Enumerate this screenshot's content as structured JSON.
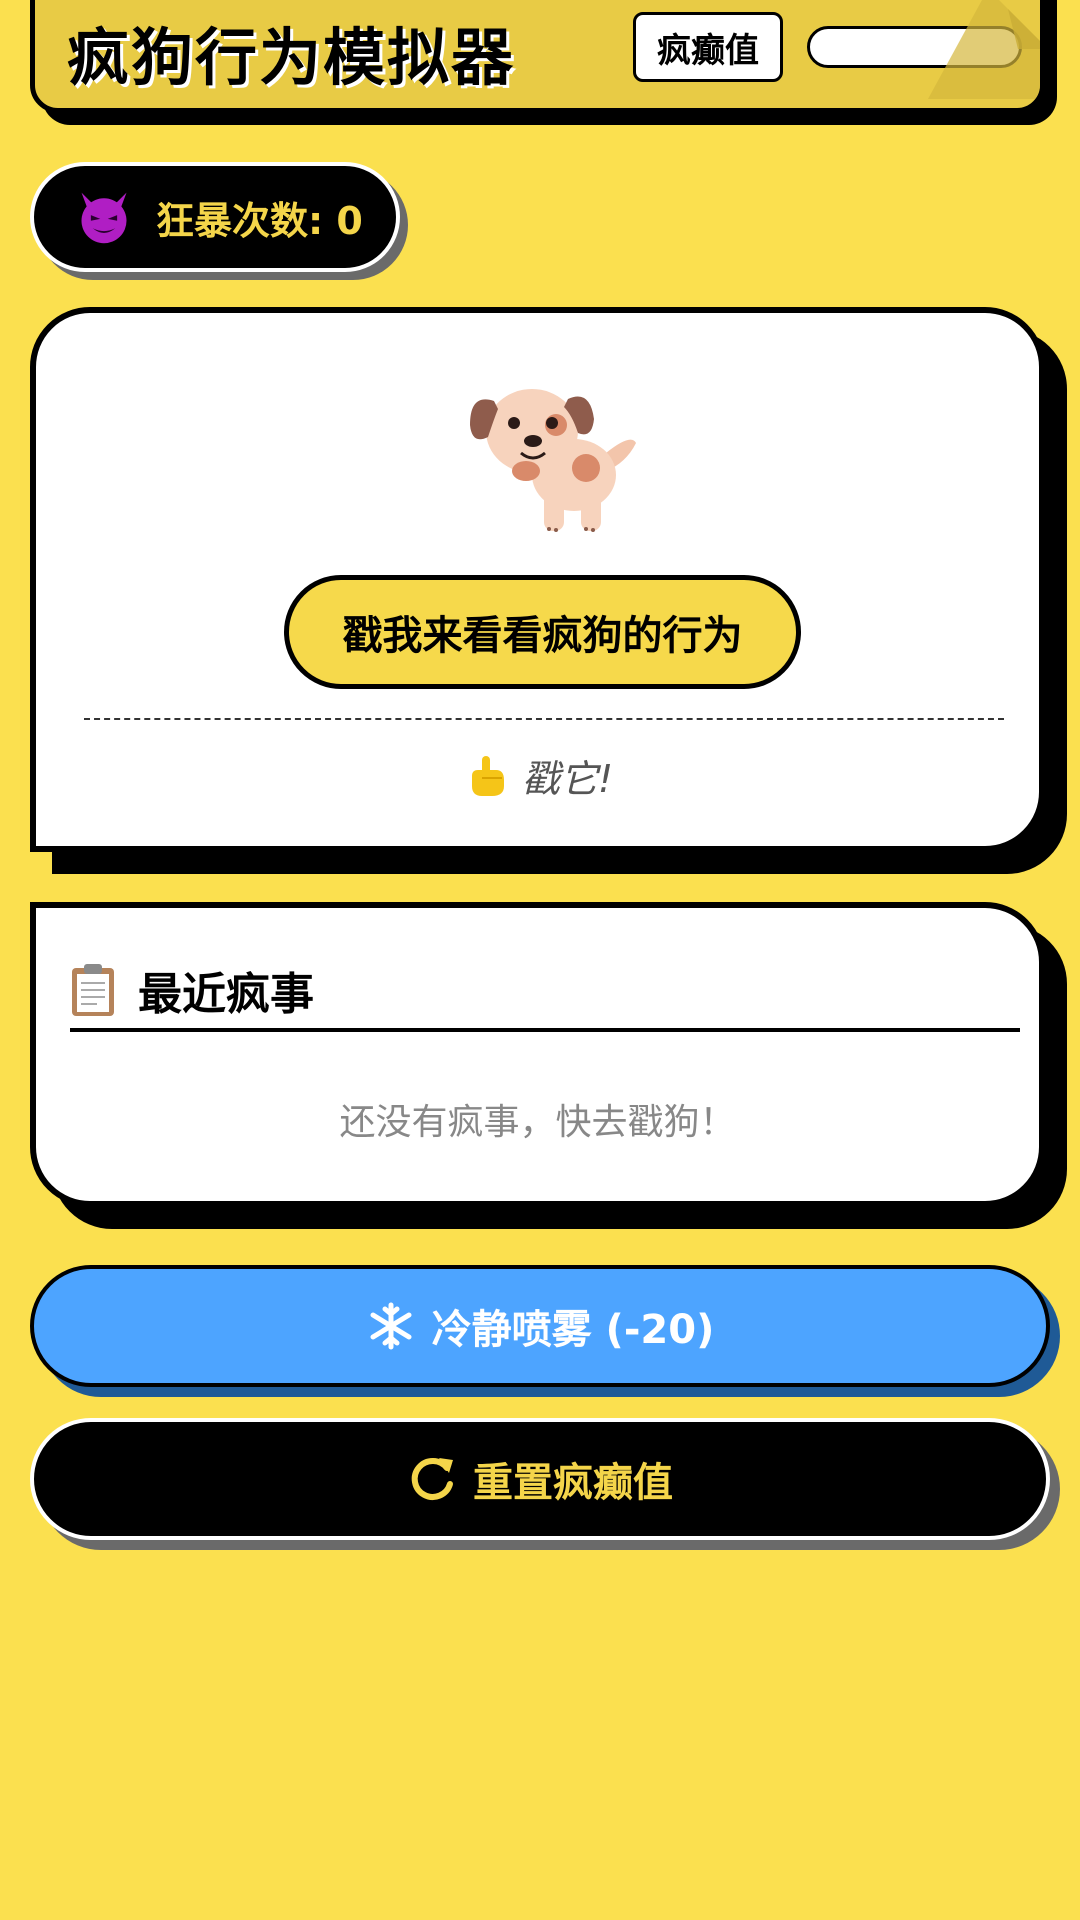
{
  "header": {
    "title": "疯狗行为模拟器",
    "meter_label": "疯癫值",
    "meter_level": 0
  },
  "stats": {
    "rage_label": "狂暴次数: 0",
    "rage_icon": "devil-face-icon"
  },
  "dog_card": {
    "dog_icon": "dog-icon",
    "poke_button_label": "戳我来看看疯狗的行为",
    "hint_icon": "pointing-hand-icon",
    "hint_text": "戳它!"
  },
  "log": {
    "icon": "clipboard-icon",
    "title": "最近疯事",
    "empty_text": "还没有疯事，快去戳狗！"
  },
  "actions": {
    "spray_icon": "snowflake-icon",
    "spray_label": "冷静喷雾 (-20)",
    "reset_icon": "reset-arrow-icon",
    "reset_label": "重置疯癫值"
  },
  "colors": {
    "background": "#fbe04f",
    "header": "#e8cb45",
    "accent_yellow": "#f4d54a",
    "spray_blue": "#4da4ff",
    "meter_fill": "#ff4d4d"
  }
}
